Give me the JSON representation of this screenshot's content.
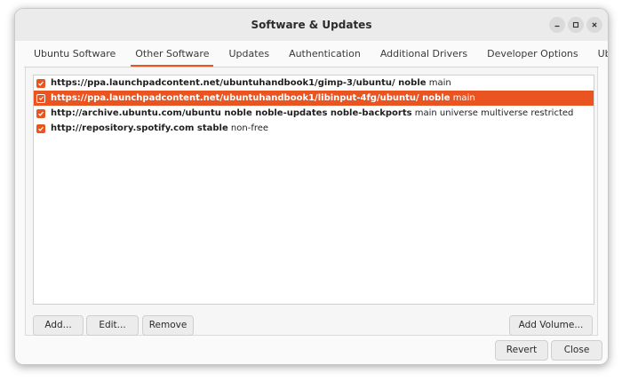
{
  "window": {
    "title": "Software & Updates"
  },
  "tabs": [
    {
      "label": "Ubuntu Software"
    },
    {
      "label": "Other Software"
    },
    {
      "label": "Updates"
    },
    {
      "label": "Authentication"
    },
    {
      "label": "Additional Drivers"
    },
    {
      "label": "Developer Options"
    },
    {
      "label": "Ubuntu Pro"
    }
  ],
  "active_tab": "Other Software",
  "sources": [
    {
      "checked": true,
      "selected": false,
      "bold": "https://ppa.launchpadcontent.net/ubuntuhandbook1/gimp-3/ubuntu/ noble",
      "rest": " main"
    },
    {
      "checked": true,
      "selected": true,
      "bold": "https://ppa.launchpadcontent.net/ubuntuhandbook1/libinput-4fg/ubuntu/ noble",
      "rest": " main"
    },
    {
      "checked": true,
      "selected": false,
      "bold": "http://archive.ubuntu.com/ubuntu noble noble-updates noble-backports",
      "rest": " main universe multiverse restricted"
    },
    {
      "checked": true,
      "selected": false,
      "bold": "http://repository.spotify.com stable",
      "rest": " non-free"
    }
  ],
  "buttons": {
    "add": "Add...",
    "edit": "Edit...",
    "remove": "Remove",
    "add_volume": "Add Volume...",
    "revert": "Revert",
    "close": "Close"
  },
  "colors": {
    "accent": "#e95420"
  },
  "icons": {
    "minimize": "minimize-icon",
    "maximize": "maximize-icon",
    "close": "close-icon",
    "check": "check-icon"
  }
}
